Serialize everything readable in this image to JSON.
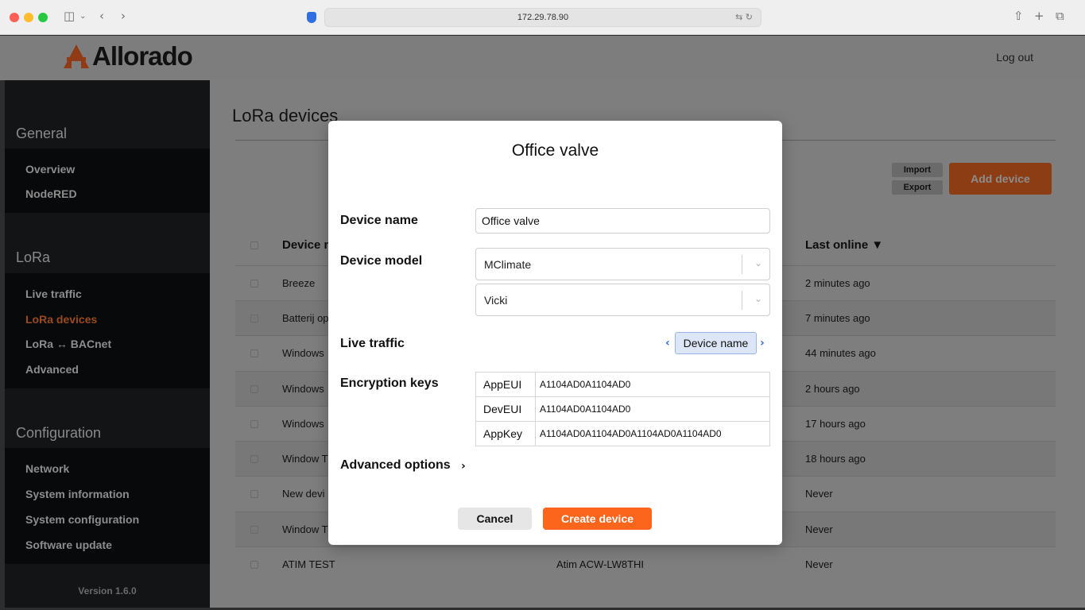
{
  "browser": {
    "url": "172.29.78.90",
    "icons": [
      "sidebar-icon",
      "chevron-down-icon",
      "back-icon",
      "forward-icon",
      "shield-icon",
      "translate-icon",
      "reload-icon",
      "share-icon",
      "new-tab-icon",
      "tabs-icon"
    ]
  },
  "header": {
    "logo_text": "Allorado",
    "logout_label": "Log out"
  },
  "sidebar": {
    "sections": [
      {
        "title": "General",
        "items": [
          "Overview",
          "NodeRED"
        ]
      },
      {
        "title": "LoRa",
        "items": [
          "Live traffic",
          "LoRa devices",
          "LoRa ↔ BACnet",
          "Advanced"
        ]
      },
      {
        "title": "Configuration",
        "items": [
          "Network",
          "System information",
          "System configuration",
          "Software update"
        ]
      }
    ],
    "active_item": "LoRa devices",
    "version": "Version 1.6.0"
  },
  "main": {
    "title": "LoRa devices",
    "import_label": "Import",
    "export_label": "Export",
    "add_device_label": "Add device",
    "columns": {
      "device": "Device n",
      "last_online": "Last online ▼"
    },
    "rows": [
      {
        "device": "Breeze",
        "model": "",
        "last_online": "2 minutes ago"
      },
      {
        "device": "Batterij op",
        "model": "",
        "last_online": "7 minutes ago"
      },
      {
        "device": "Windows",
        "model": "",
        "last_online": "44 minutes ago"
      },
      {
        "device": "Windows",
        "model": "",
        "last_online": "2 hours ago"
      },
      {
        "device": "Windows",
        "model": "",
        "last_online": "17 hours ago"
      },
      {
        "device": "Window T",
        "model": "",
        "last_online": "18 hours ago"
      },
      {
        "device": "New devi",
        "model": "",
        "last_online": "Never"
      },
      {
        "device": "Window T",
        "model": "",
        "last_online": "Never"
      },
      {
        "device": "ATIM TEST",
        "model": "Atim ACW-LW8THI",
        "last_online": "Never"
      }
    ]
  },
  "modal": {
    "title": "Office valve",
    "device_name_label": "Device name",
    "device_name_value": "Office valve",
    "device_model_label": "Device model",
    "manufacturer_value": "MClimate",
    "model_value": "Vicki",
    "live_traffic_label": "Live traffic",
    "live_traffic_pill": "Device name",
    "encryption_label": "Encryption keys",
    "keys": [
      {
        "name": "AppEUI",
        "value": "A1104AD0A1104AD0"
      },
      {
        "name": "DevEUI",
        "value": "A1104AD0A1104AD0"
      },
      {
        "name": "AppKey",
        "value": "A1104AD0A1104AD0A1104AD0A1104AD0"
      }
    ],
    "advanced_label": "Advanced options",
    "cancel_label": "Cancel",
    "create_label": "Create device"
  },
  "colors": {
    "accent": "#fb651c",
    "link_blue": "#2f6bd0"
  }
}
